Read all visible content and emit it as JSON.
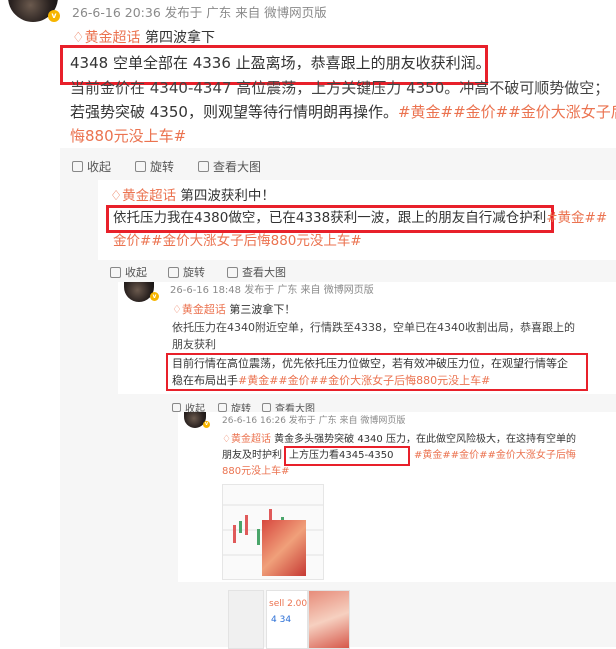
{
  "post1": {
    "meta": "26-6-16 20:36 发布于 广东 来自 微博网页版",
    "topic": "黄金超话",
    "title": "第四波拿下",
    "highlight": "4348 空单全部在 4336 止盈离场，恭喜跟上的朋友收获利润。",
    "line2": "当前金价在 4340-4347 高位震荡，上方关键压力 4350。冲高不破可顺势做空；",
    "line3a": "若强势突破 4350，则观望等待行情明朗再操作。",
    "tags1": "#黄金##金价##金价大涨女子后",
    "tags2": "悔880元没上车#"
  },
  "toolbar1": {
    "collect": "收起",
    "rotate": "旋转",
    "view": "查看大图"
  },
  "post2": {
    "topic": "黄金超话",
    "title": "第四波获利中！",
    "highlight": "依托压力我在4380做空，已在4338获利一波，跟上的朋友自行减仓护利",
    "tags_a": "#黄金##",
    "tags_b": "金价##金价大涨女子后悔880元没上车#"
  },
  "toolbar2": {
    "collect": "收起",
    "rotate": "旋转",
    "view": "查看大图"
  },
  "post3": {
    "meta": "26-6-16 18:48 发布于 广东 来自 微博网页版",
    "topic": "黄金超话",
    "title": "第三波拿下！",
    "l1": "依托压力在4340附近空单，行情跌至4338，空单已在4340收割出局，恭喜跟上的",
    "l2": "朋友获利",
    "h1": "目前行情在高位震荡，优先依托压力位做空，若有效冲破压力位，在观望行情等企",
    "h2a": "稳在布局出手",
    "h2tags": "#黄金##金价##金价大涨女子后悔880元没上车#"
  },
  "toolbar3": {
    "collect": "收起",
    "rotate": "旋转",
    "view": "查看大图"
  },
  "post4": {
    "meta": "26-6-16 16:26 发布于 广东 来自 微博网页版",
    "topic": "黄金超话",
    "l1a": "黄金多头强势突破 4340 压力，在此做空风险极大，在这持有空单的",
    "l2a": "朋友及时护利",
    "h": "上方压力看4345-4350",
    "tags": "#黄金##金价##金价大涨女子后悔",
    "l3": "880元没上车#"
  },
  "thumbs": {
    "sell": "sell 2.00",
    "price": "4 34"
  },
  "colors": {
    "accent": "#eb7350",
    "highlight_box": "#e8202a"
  }
}
